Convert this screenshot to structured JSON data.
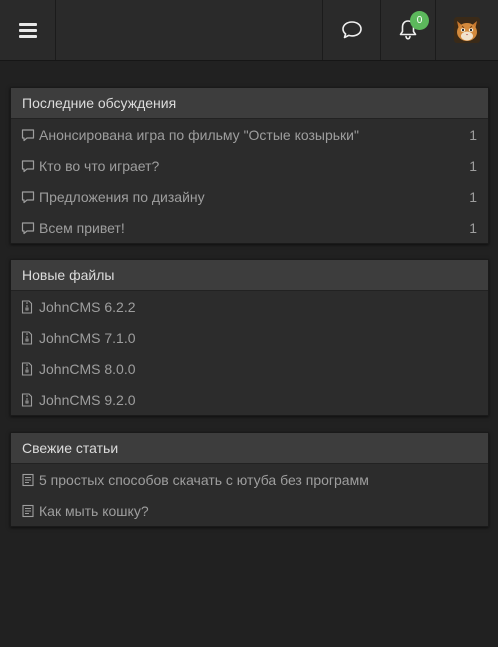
{
  "header": {
    "notifications_count": "0",
    "icons": [
      "menu-icon",
      "chat-bubble-icon",
      "bell-icon",
      "avatar-cat"
    ]
  },
  "discussions": {
    "title": "Последние обсуждения",
    "items": [
      {
        "label": "Анонсирована игра по фильму \"Остые козырьки\"",
        "count": "1"
      },
      {
        "label": "Кто во что играет?",
        "count": "1"
      },
      {
        "label": "Предложения по дизайну",
        "count": "1"
      },
      {
        "label": "Всем привет!",
        "count": "1"
      }
    ]
  },
  "files": {
    "title": "Новые файлы",
    "items": [
      {
        "label": "JohnCMS 6.2.2"
      },
      {
        "label": "JohnCMS 7.1.0"
      },
      {
        "label": "JohnCMS 8.0.0"
      },
      {
        "label": "JohnCMS 9.2.0"
      }
    ]
  },
  "articles": {
    "title": "Свежие статьи",
    "items": [
      {
        "label": "5 простых способов скачать с ютуба без программ"
      },
      {
        "label": "Как мыть кошку?"
      }
    ]
  },
  "colors": {
    "background": "#212121",
    "panel": "#2c2c2c",
    "panel_header": "#3d3d3d",
    "badge": "#5cb85c"
  }
}
